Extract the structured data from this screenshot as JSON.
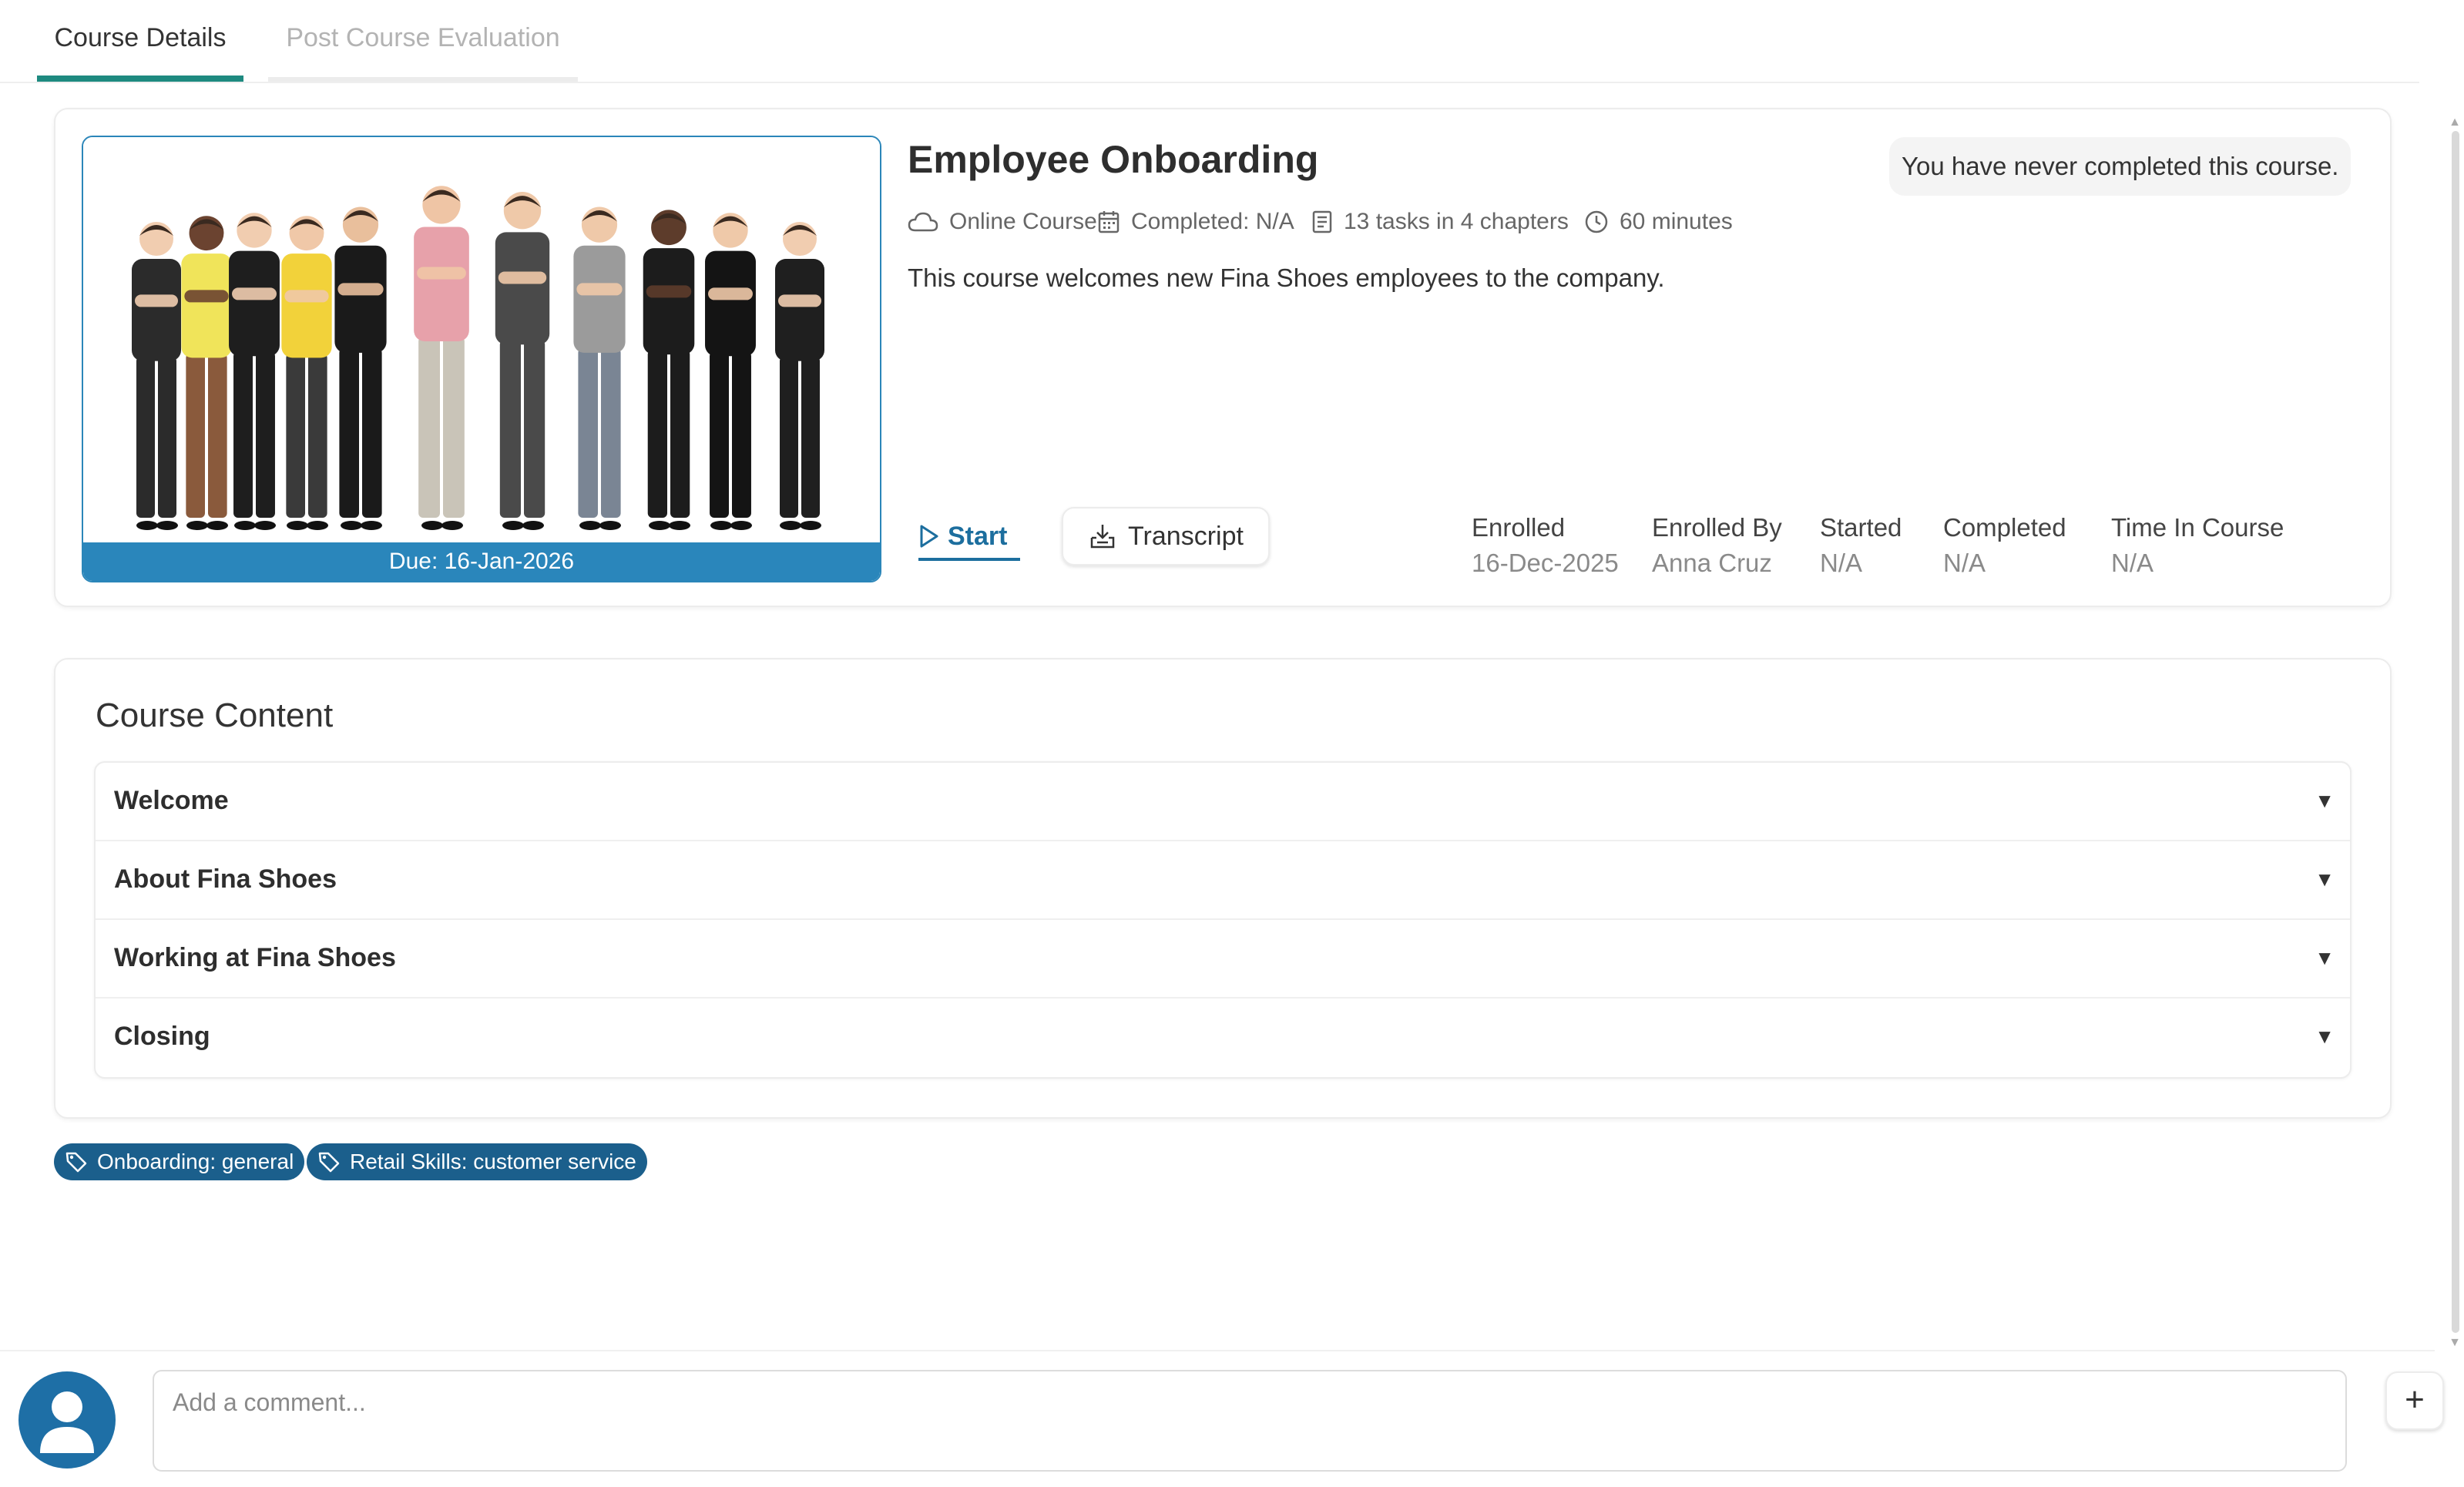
{
  "tabs": [
    {
      "label": "Course Details",
      "active": true
    },
    {
      "label": "Post Course Evaluation",
      "active": false
    }
  ],
  "course": {
    "title": "Employee Onboarding",
    "status_note": "You have never completed this course.",
    "due": "Due: 16-Jan-2026",
    "meta": {
      "type": "Online Course",
      "completed": "Completed: N/A",
      "tasks": "13 tasks in 4 chapters",
      "duration": "60 minutes"
    },
    "description": "This course welcomes new Fina Shoes employees to the company.",
    "start_label": "Start",
    "transcript_label": "Transcript",
    "stats": [
      {
        "label": "Enrolled",
        "value": "16-Dec-2025"
      },
      {
        "label": "Enrolled By",
        "value": "Anna Cruz"
      },
      {
        "label": "Started",
        "value": "N/A"
      },
      {
        "label": "Completed",
        "value": "N/A"
      },
      {
        "label": "Time In Course",
        "value": "N/A"
      }
    ]
  },
  "content": {
    "title": "Course Content",
    "chapters": [
      "Welcome",
      "About Fina Shoes",
      "Working at Fina Shoes",
      "Closing"
    ]
  },
  "tags": [
    "Onboarding: general",
    "Retail Skills: customer service"
  ],
  "comment": {
    "placeholder": "Add a comment..."
  },
  "colors": {
    "accent_teal": "#1e8a80",
    "accent_blue": "#2a86bb",
    "tag_blue": "#1b5f8c",
    "link_blue": "#1c6e9e"
  },
  "icons": [
    "cloud-icon",
    "calendar-icon",
    "document-icon",
    "clock-icon",
    "play-icon",
    "download-icon",
    "tag-icon",
    "user-avatar-icon",
    "plus-icon",
    "caret-down-icon"
  ]
}
